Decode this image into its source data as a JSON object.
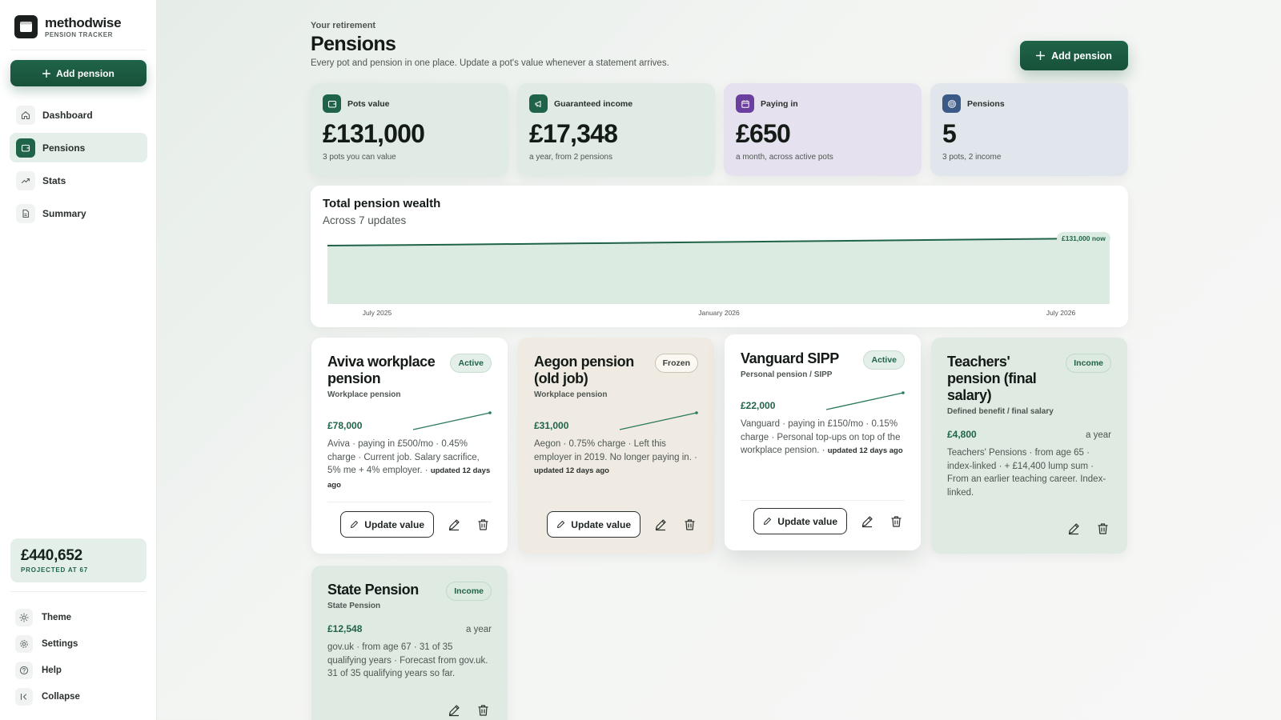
{
  "brand": {
    "name": "methodwise",
    "subtitle": "PENSION TRACKER"
  },
  "sidebar": {
    "add_label": "Add pension",
    "items": [
      {
        "label": "Dashboard",
        "icon": "home-icon"
      },
      {
        "label": "Pensions",
        "icon": "wallet-icon",
        "active": true
      },
      {
        "label": "Stats",
        "icon": "trend-icon"
      },
      {
        "label": "Summary",
        "icon": "document-icon"
      }
    ],
    "projected_value": "£440,652",
    "projected_label": "PROJECTED AT 67",
    "footer": [
      {
        "label": "Theme",
        "icon": "sun-icon"
      },
      {
        "label": "Settings",
        "icon": "gear-icon"
      },
      {
        "label": "Help",
        "icon": "help-icon"
      },
      {
        "label": "Collapse",
        "icon": "collapse-icon"
      }
    ]
  },
  "header": {
    "eyebrow": "Your retirement",
    "title": "Pensions",
    "subtitle": "Every pot and pension in one place. Update a pot's value whenever a statement arrives.",
    "add_label": "Add pension"
  },
  "stats": [
    {
      "label": "Pots value",
      "value": "£131,000",
      "note": "3 pots you can value",
      "icon": "wallet-icon",
      "color": "#1f6448"
    },
    {
      "label": "Guaranteed income",
      "value": "£17,348",
      "note": "a year, from 2 pensions",
      "icon": "megaphone-icon",
      "color": "#1f6448"
    },
    {
      "label": "Paying in",
      "value": "£650",
      "note": "a month, across active pots",
      "icon": "calendar-icon",
      "color": "#6b3fa0"
    },
    {
      "label": "Pensions",
      "value": "5",
      "note": "3 pots, 2 income",
      "icon": "target-icon",
      "color": "#3b5a86"
    }
  ],
  "wealth": {
    "title": "Total pension wealth",
    "subtitle": "Across 7 updates",
    "now_label": "£131,000 now"
  },
  "chart_data": {
    "type": "area",
    "x_ticks": [
      "July 2025",
      "January 2026",
      "July 2026"
    ],
    "values": [
      124000,
      125000,
      126200,
      127400,
      128600,
      129800,
      131000
    ],
    "ylim": [
      0,
      131000
    ],
    "color": "#1f6448"
  },
  "labels": {
    "update_value": "Update value"
  },
  "pensions": [
    {
      "name": "Aviva workplace pension",
      "type": "Workplace pension",
      "badge": "Active",
      "value": "£78,000",
      "freq": "",
      "desc": "Aviva · paying in £500/mo · 0.45% charge · Current job. Salary sacrifice, 5% me + 4% employer. ·",
      "updated": "updated 12 days ago"
    },
    {
      "name": "Aegon pension (old job)",
      "type": "Workplace pension",
      "badge": "Frozen",
      "value": "£31,000",
      "freq": "",
      "desc": "Aegon · 0.75% charge · Left this employer in 2019. No longer paying in. ·",
      "updated": "updated 12 days ago"
    },
    {
      "name": "Vanguard SIPP",
      "type": "Personal pension / SIPP",
      "badge": "Active",
      "value": "£22,000",
      "freq": "",
      "desc": "Vanguard · paying in £150/mo · 0.15% charge · Personal top-ups on top of the workplace pension. ·",
      "updated": "updated 12 days ago"
    },
    {
      "name": "Teachers' pension (final salary)",
      "type": "Defined benefit / final salary",
      "badge": "Income",
      "value": "£4,800",
      "freq": "a year",
      "desc": "Teachers' Pensions · from age 65 · index-linked · + £14,400 lump sum · From an earlier teaching career. Index-linked.",
      "updated": ""
    },
    {
      "name": "State Pension",
      "type": "State Pension",
      "badge": "Income",
      "value": "£12,548",
      "freq": "a year",
      "desc": "gov.uk · from age 67 · 31 of 35 qualifying years · Forecast from gov.uk. 31 of 35 qualifying years so far.",
      "updated": ""
    }
  ]
}
